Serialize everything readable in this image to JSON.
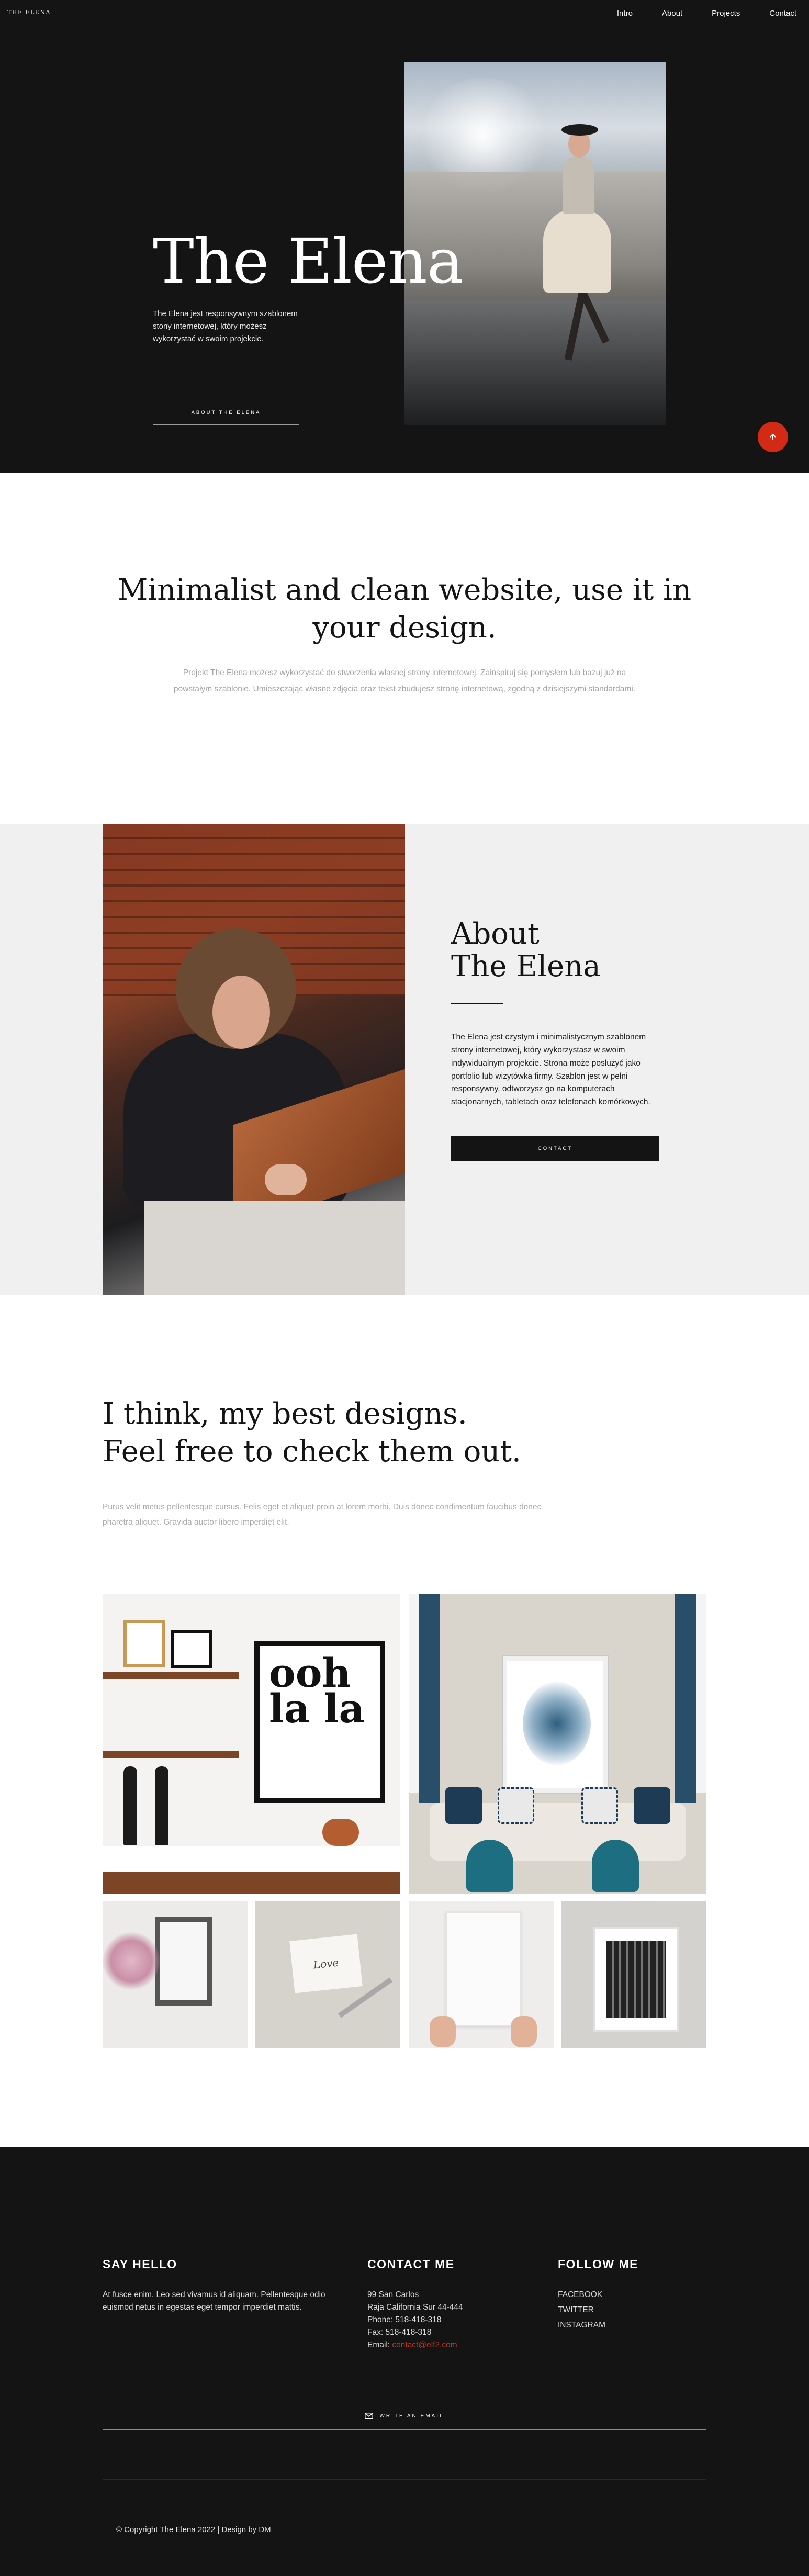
{
  "logo": {
    "text": "THE ELENA"
  },
  "nav": {
    "items": [
      "Intro",
      "About",
      "Projects",
      "Contact"
    ]
  },
  "hero": {
    "title": "The Elena",
    "description": "The Elena jest responsywnym szablonem stony internetowej, który możesz wykorzystać w swoim projekcie.",
    "button": "ABOUT THE ELENA"
  },
  "intro": {
    "heading": "Minimalist and clean website, use it in your design.",
    "text": "Projekt The Elena możesz wykorzystać do stworzenia własnej strony internetowej. Zainspiruj się pomysłem lub bazuj już na powstałym szablonie. Umieszczając własne zdjęcia oraz tekst zbudujesz stronę internetową, zgodną z dzisiejszymi standardami."
  },
  "about": {
    "heading_line1": "About",
    "heading_line2": "The Elena",
    "text": "The Elena jest czystym i minimalistycznym szablonem strony internetowej, który wykorzystasz w swoim indywidualnym projekcie. Strona może posłużyć jako portfolio lub wizytówka firmy. Szablon jest w pełni responsywny, odtworzysz go na komputerach stacjonarnych, tabletach oraz telefonach komórkowych.",
    "button": "CONTACT"
  },
  "projects": {
    "heading_line1": "I think, my best designs.",
    "heading_line2": "Feel free to check them out.",
    "text": "Purus velit metus pellentesque cursus. Felis eget et aliquet proin at lorem morbi. Duis donec condimentum faucibus donec pharetra aliquet. Gravida auctor libero imperdiet elit.",
    "poster_text": "ooh la la",
    "card_text": "Love"
  },
  "footer": {
    "hello_heading": "SAY HELLO",
    "hello_text": "At fusce enim. Leo sed vivamus id aliquam. Pellentesque odio euismod netus in egestas eget tempor imperdiet mattis.",
    "contact_heading": "CONTACT ME",
    "address1": "99 San Carlos",
    "address2": "Raja California Sur 44-444",
    "phone": "Phone: 518-418-318",
    "fax": "Fax: 518-418-318",
    "email_label": "Email:",
    "email": "contact@elf2.com",
    "follow_heading": "FOLLOW ME",
    "social": [
      "FACEBOOK",
      "TWITTER",
      "INSTAGRAM"
    ],
    "email_button": "WRITE AN EMAIL",
    "copyright": "© Copyright The Elena 2022 | Design by DM"
  },
  "colors": {
    "dark": "#141414",
    "accent": "#d32a15",
    "light_bg": "#f0f0f0",
    "muted_text": "#a3a3a3"
  },
  "icons": {
    "scroll_top": "arrow-up-icon",
    "email": "envelope-icon"
  }
}
